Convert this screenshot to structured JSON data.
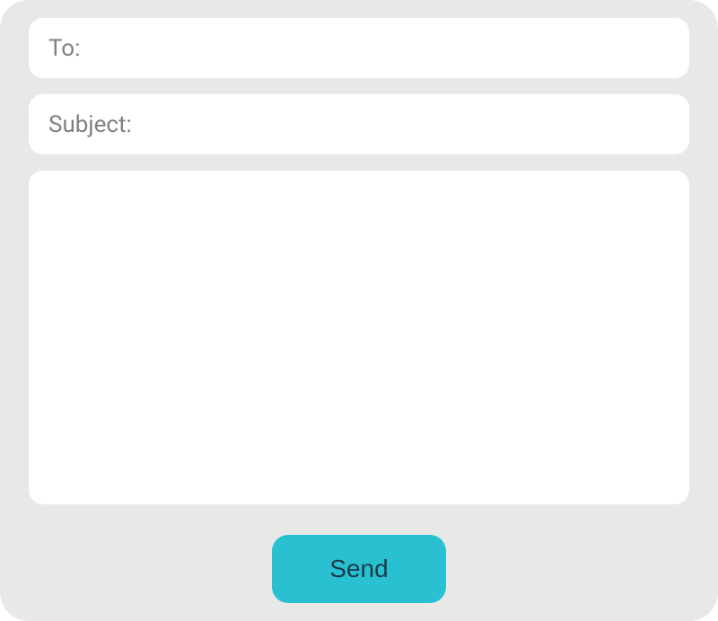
{
  "compose": {
    "to_label": "To:",
    "to_value": "",
    "subject_label": "Subject:",
    "subject_value": "",
    "body_value": "",
    "send_label": "Send"
  }
}
